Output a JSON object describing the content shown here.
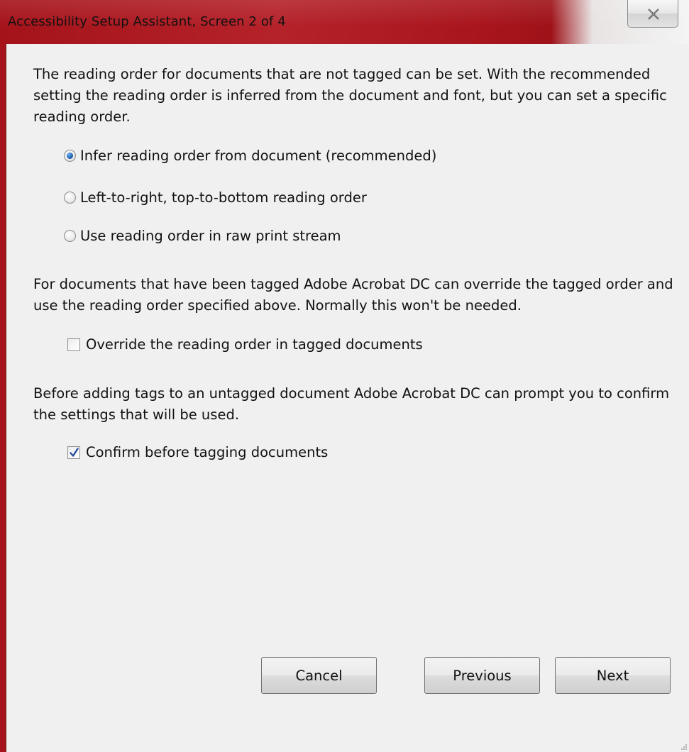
{
  "window": {
    "title": "Accessibility Setup Assistant, Screen 2 of 4"
  },
  "content": {
    "intro_text": "The reading order for documents that are not tagged can be set. With the recommended setting the reading order is inferred from the document and font, but you can set a specific reading order.",
    "reading_order_options": [
      {
        "label": "Infer reading order from document (recommended)",
        "selected": true
      },
      {
        "label": "Left-to-right, top-to-bottom reading order",
        "selected": false
      },
      {
        "label": "Use reading order in raw print stream",
        "selected": false
      }
    ],
    "tagged_text": "For documents that have been tagged Adobe Acrobat DC can override the tagged order and use the reading order specified above. Normally this won't be needed.",
    "override_checkbox": {
      "label": "Override the reading order in tagged documents",
      "checked": false
    },
    "confirm_text": "Before adding tags to an untagged document Adobe Acrobat DC can prompt you to confirm the settings that will be used.",
    "confirm_checkbox": {
      "label": "Confirm before tagging documents",
      "checked": true
    }
  },
  "buttons": {
    "cancel": "Cancel",
    "previous": "Previous",
    "next": "Next"
  },
  "colors": {
    "title_bar_accent": "#a8141b",
    "radio_selected": "#1f5fb0",
    "checkmark": "#2a4d9c"
  }
}
